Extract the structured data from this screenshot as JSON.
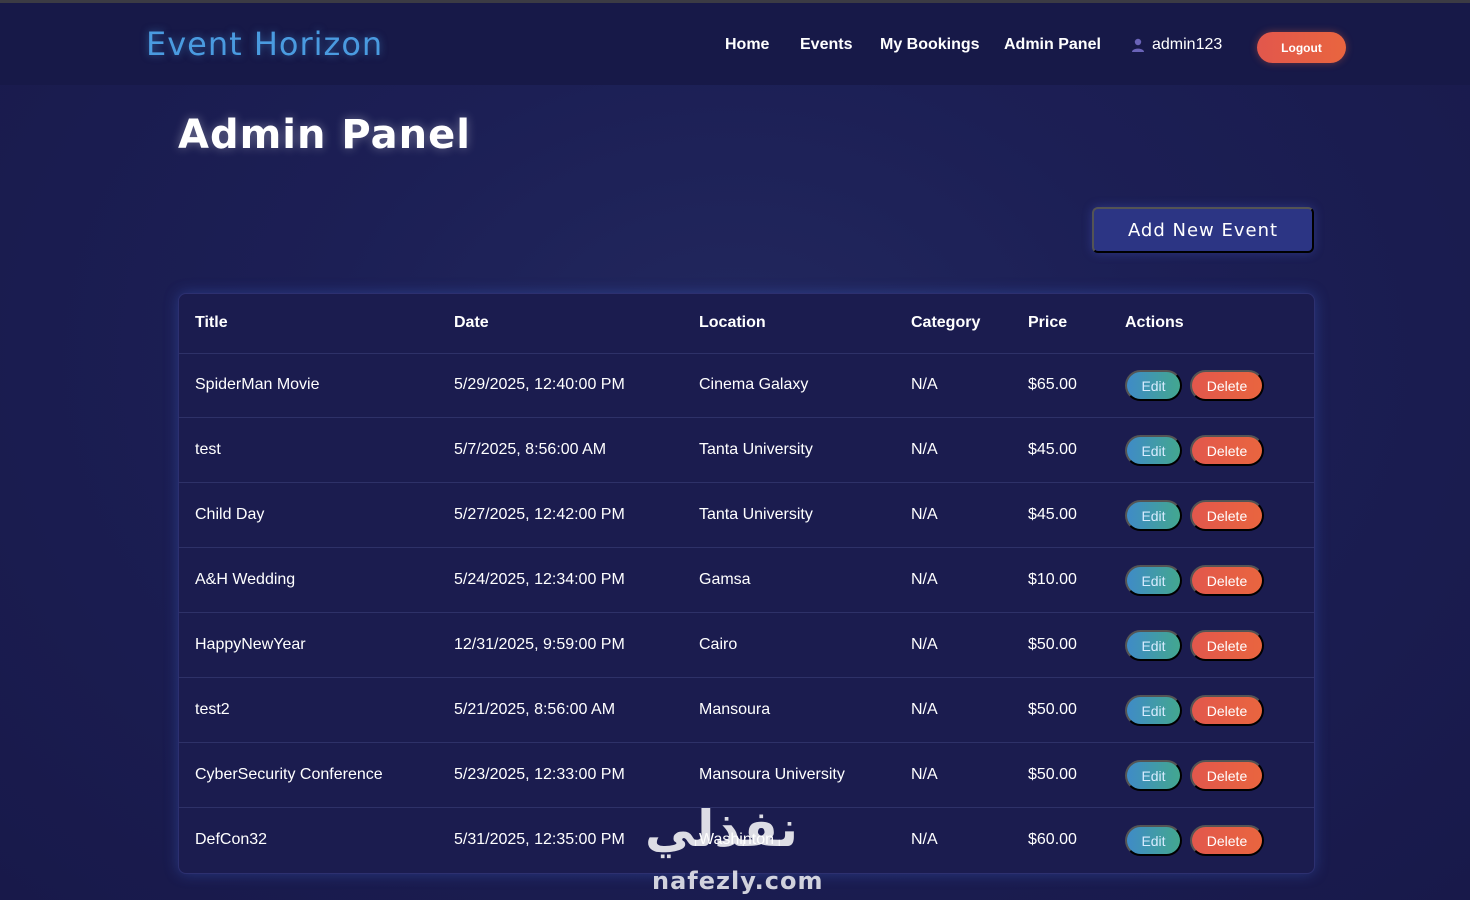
{
  "brand": {
    "logo_text": "Event Horizon"
  },
  "nav": {
    "links": [
      {
        "label": "Home"
      },
      {
        "label": "Events"
      },
      {
        "label": "My Bookings"
      },
      {
        "label": "Admin Panel"
      }
    ],
    "username": "admin123",
    "logout_label": "Logout"
  },
  "page": {
    "title": "Admin Panel",
    "add_button_label": "Add New Event"
  },
  "table": {
    "headers": [
      "Title",
      "Date",
      "Location",
      "Category",
      "Price",
      "Actions"
    ],
    "rows": [
      {
        "title": "SpiderMan Movie",
        "date": "5/29/2025, 12:40:00 PM",
        "location": "Cinema Galaxy",
        "category": "N/A",
        "price": "$65.00"
      },
      {
        "title": "test",
        "date": "5/7/2025, 8:56:00 AM",
        "location": "Tanta University",
        "category": "N/A",
        "price": "$45.00"
      },
      {
        "title": "Child Day",
        "date": "5/27/2025, 12:42:00 PM",
        "location": "Tanta University",
        "category": "N/A",
        "price": "$45.00"
      },
      {
        "title": "A&H Wedding",
        "date": "5/24/2025, 12:34:00 PM",
        "location": "Gamsa",
        "category": "N/A",
        "price": "$10.00"
      },
      {
        "title": "HappyNewYear",
        "date": "12/31/2025, 9:59:00 PM",
        "location": "Cairo",
        "category": "N/A",
        "price": "$50.00"
      },
      {
        "title": "test2",
        "date": "5/21/2025, 8:56:00 AM",
        "location": "Mansoura",
        "category": "N/A",
        "price": "$50.00"
      },
      {
        "title": "CyberSecurity Conference",
        "date": "5/23/2025, 12:33:00 PM",
        "location": "Mansoura University",
        "category": "N/A",
        "price": "$50.00"
      },
      {
        "title": "DefCon32",
        "date": "5/31/2025, 12:35:00 PM",
        "location": "Washinton",
        "category": "N/A",
        "price": "$60.00"
      }
    ],
    "edit_label": "Edit",
    "delete_label": "Delete"
  },
  "watermark": {
    "arabic_text": "نفذلي",
    "site_text": "nafezly.com"
  }
}
